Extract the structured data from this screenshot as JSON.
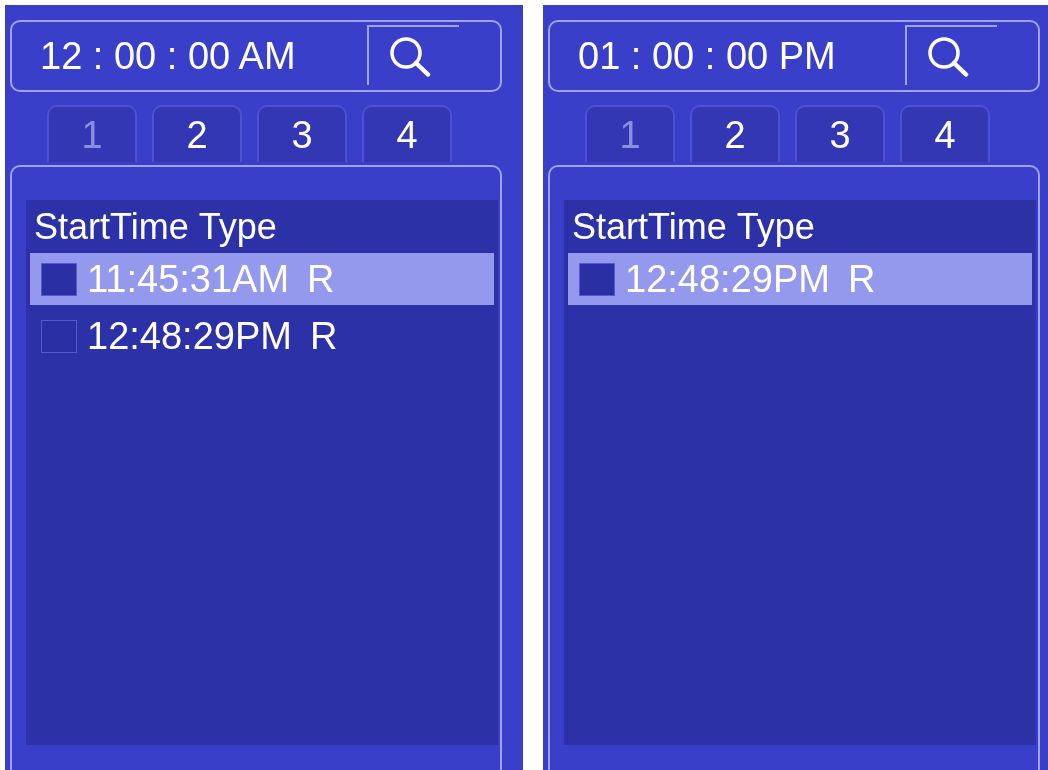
{
  "panels": [
    {
      "time_field": {
        "value": "12 : 00 : 00 AM"
      },
      "tabs": [
        {
          "label": "1",
          "selected": true
        },
        {
          "label": "2",
          "selected": false
        },
        {
          "label": "3",
          "selected": false
        },
        {
          "label": "4",
          "selected": false
        }
      ],
      "list": {
        "columns": [
          "StartTime",
          "Type"
        ],
        "rows": [
          {
            "start_time": "11:45:31AM",
            "type": "R",
            "selected": true
          },
          {
            "start_time": "12:48:29PM",
            "type": "R",
            "selected": false
          }
        ]
      }
    },
    {
      "time_field": {
        "value": "01 : 00 : 00 PM"
      },
      "tabs": [
        {
          "label": "1",
          "selected": true
        },
        {
          "label": "2",
          "selected": false
        },
        {
          "label": "3",
          "selected": false
        },
        {
          "label": "4",
          "selected": false
        }
      ],
      "list": {
        "columns": [
          "StartTime",
          "Type"
        ],
        "rows": [
          {
            "start_time": "12:48:29PM",
            "type": "R",
            "selected": true
          }
        ]
      }
    }
  ]
}
